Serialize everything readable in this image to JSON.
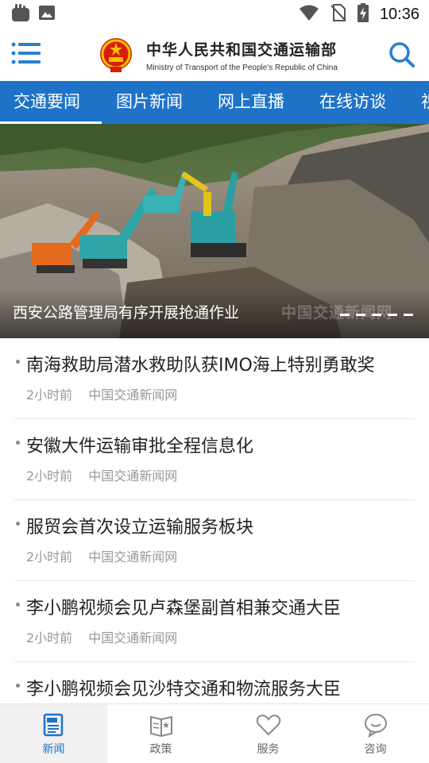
{
  "status_bar": {
    "time": "10:36"
  },
  "header": {
    "title_cn": "中华人民共和国交通运输部",
    "title_en": "Ministry of Transport of the People's Republic of China"
  },
  "tabs": [
    {
      "label": "交通要闻",
      "active": true
    },
    {
      "label": "图片新闻",
      "active": false
    },
    {
      "label": "网上直播",
      "active": false
    },
    {
      "label": "在线访谈",
      "active": false
    },
    {
      "label": "视",
      "active": false
    }
  ],
  "hero": {
    "caption": "西安公路管理局有序开展抢通作业",
    "watermark": "中国交通新闻网",
    "slide_count": 5
  },
  "news": [
    {
      "title": "南海救助局潜水救助队获IMO海上特别勇敢奖",
      "time": "2小时前",
      "source": "中国交通新闻网"
    },
    {
      "title": "安徽大件运输审批全程信息化",
      "time": "2小时前",
      "source": "中国交通新闻网"
    },
    {
      "title": "服贸会首次设立运输服务板块",
      "time": "2小时前",
      "source": "中国交通新闻网"
    },
    {
      "title": "李小鹏视频会见卢森堡副首相兼交通大臣",
      "time": "2小时前",
      "source": "中国交通新闻网"
    },
    {
      "title": "李小鹏视频会见沙特交通和物流服务大臣",
      "time": "",
      "source": ""
    }
  ],
  "bottom_nav": [
    {
      "label": "新闻",
      "icon": "news-icon",
      "active": true
    },
    {
      "label": "政策",
      "icon": "policy-icon",
      "active": false
    },
    {
      "label": "服务",
      "icon": "heart-icon",
      "active": false
    },
    {
      "label": "咨询",
      "icon": "chat-bubble-icon",
      "active": false
    }
  ],
  "colors": {
    "accent": "#1e73c8",
    "tab_bar": "#1e73c8"
  }
}
